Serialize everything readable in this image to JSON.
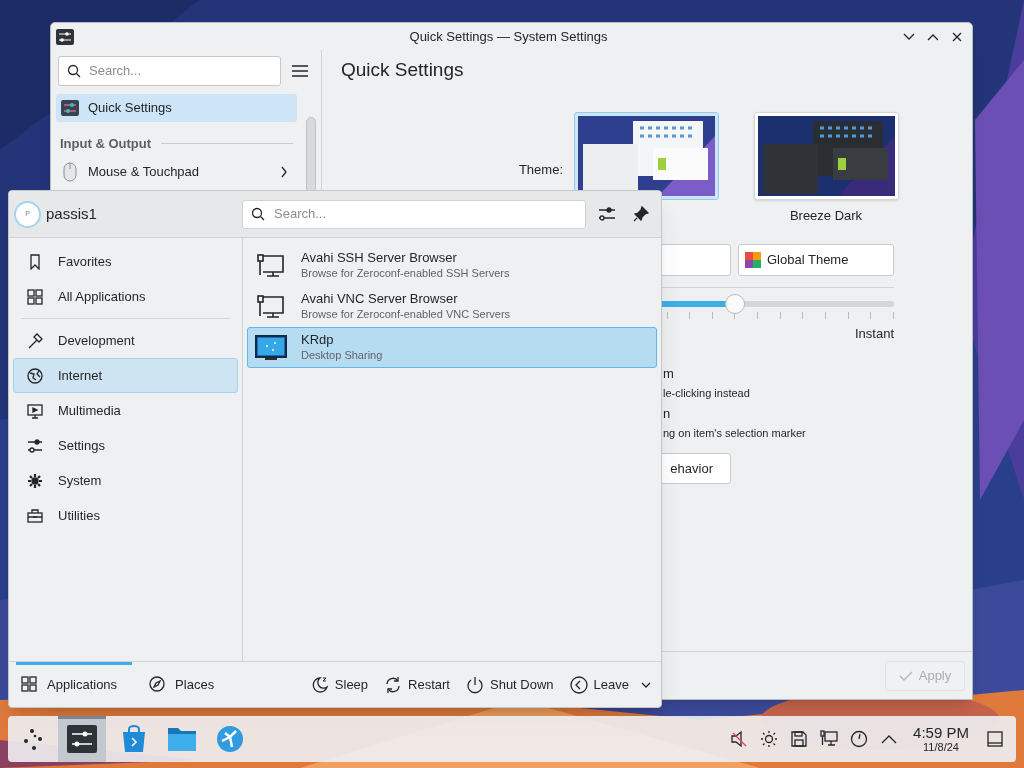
{
  "settings_window": {
    "title": "Quick Settings — System Settings",
    "search_placeholder": "Search...",
    "sidebar": [
      {
        "kind": "item",
        "label": "Quick Settings",
        "selected": true
      },
      {
        "kind": "header",
        "label": "Input & Output"
      },
      {
        "kind": "item",
        "label": "Mouse & Touchpad",
        "selected": false
      }
    ],
    "page_title": "Quick Settings",
    "theme_label": "Theme:",
    "themes": [
      {
        "selected": true
      },
      {
        "label": "Breeze Dark",
        "selected": false
      }
    ],
    "global_theme_button": "Global Theme",
    "animation_speed": {
      "level": 0.5,
      "max_label": "Instant"
    },
    "click_behavior": [
      {
        "text": "m",
        "hint": "le-clicking instead"
      },
      {
        "text": "n",
        "hint": "ng on item's selection marker"
      }
    ],
    "general_behavior_button": "ehavior",
    "apply_button": {
      "label": "Apply",
      "disabled": true
    }
  },
  "launcher": {
    "avatar": "P",
    "user": "passis1",
    "search_placeholder": "Search...",
    "categories": [
      {
        "kind": "category",
        "label": "Favorites",
        "selected": false
      },
      {
        "kind": "category",
        "label": "All Applications",
        "selected": false
      },
      {
        "kind": "separator"
      },
      {
        "kind": "category",
        "label": "Development",
        "selected": false
      },
      {
        "kind": "category",
        "label": "Internet",
        "selected": true
      },
      {
        "kind": "category",
        "label": "Multimedia",
        "selected": false
      },
      {
        "kind": "category",
        "label": "Settings",
        "selected": false
      },
      {
        "kind": "category",
        "label": "System",
        "selected": false
      },
      {
        "kind": "category",
        "label": "Utilities",
        "selected": false
      }
    ],
    "apps": [
      {
        "name": "Avahi SSH Server Browser",
        "description": "Browse for Zeroconf-enabled SSH Servers",
        "selected": false
      },
      {
        "name": "Avahi VNC Server Browser",
        "description": "Browse for Zeroconf-enabled VNC Servers",
        "selected": false
      },
      {
        "name": "KRdp",
        "description": "Desktop Sharing",
        "selected": true
      }
    ],
    "tabs": [
      {
        "label": "Applications",
        "selected": true
      },
      {
        "label": "Places",
        "selected": false
      }
    ],
    "power_buttons": [
      {
        "kind": "sleep",
        "label": "Sleep"
      },
      {
        "kind": "restart",
        "label": "Restart"
      },
      {
        "kind": "shutdown",
        "label": "Shut Down"
      },
      {
        "kind": "leave",
        "label": "Leave"
      }
    ]
  },
  "taskbar": {
    "tasks": [
      {
        "active": false
      },
      {
        "active": true
      },
      {
        "active": false
      },
      {
        "active": false
      },
      {
        "active": false
      }
    ],
    "time": "4:59 PM",
    "date": "11/8/24"
  }
}
